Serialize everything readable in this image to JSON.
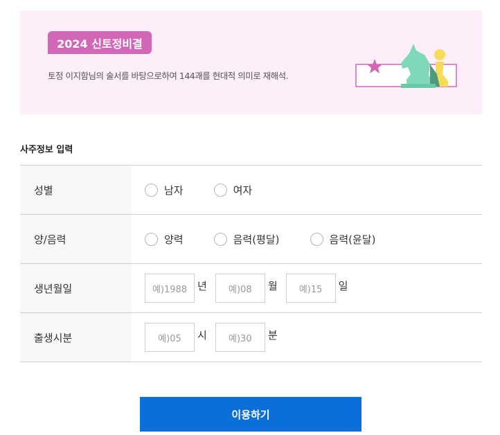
{
  "banner": {
    "badge": "2024 신토정비결",
    "description": "토정 이지함님의 술서를 바탕으로하여 144괘를 현대적 의미로 재해석."
  },
  "form": {
    "section_title": "사주정보 입력",
    "gender": {
      "label": "성별",
      "options": [
        "남자",
        "여자"
      ]
    },
    "calendar": {
      "label": "양/음력",
      "options": [
        "양력",
        "음력(평달)",
        "음력(윤달)"
      ]
    },
    "birthdate": {
      "label": "생년월일",
      "year_placeholder": "예)1988",
      "year_unit": "년",
      "month_placeholder": "예)08",
      "month_unit": "월",
      "day_placeholder": "예)15",
      "day_unit": "일"
    },
    "birthtime": {
      "label": "출생시분",
      "hour_placeholder": "예)05",
      "hour_unit": "시",
      "minute_placeholder": "예)30",
      "minute_unit": "분"
    }
  },
  "submit_label": "이용하기",
  "colors": {
    "accent_pink": "#d267b7",
    "banner_bg": "#fdeefa",
    "button_blue": "#0a6fd8"
  },
  "icons": {
    "banner_illustration": "chess-knight-pawn-illustration"
  }
}
